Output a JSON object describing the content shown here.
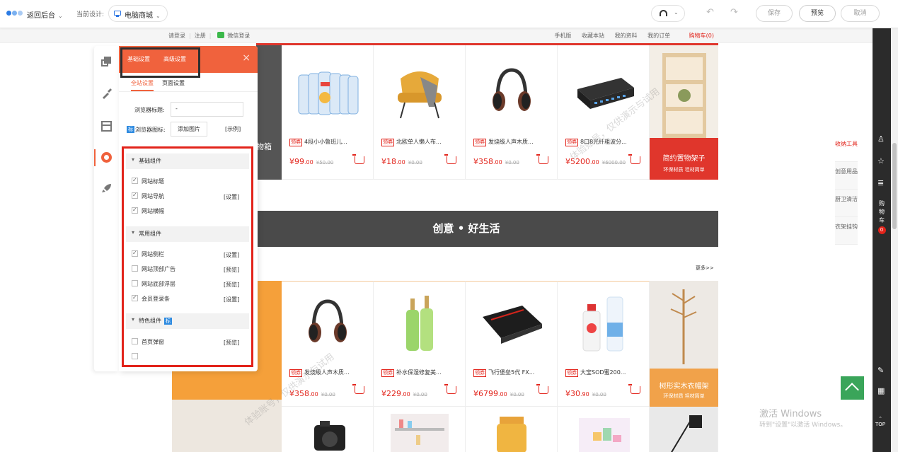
{
  "toolbar": {
    "back_label": "返回后台",
    "current_design_label": "当前设计:",
    "device_value": "电脑商城",
    "save_label": "保存",
    "preview_label": "预览",
    "cancel_label": "取消"
  },
  "shop_topbar": {
    "login": "请登录",
    "register": "注册",
    "wechat_login": "微信登录",
    "mobile": "手机版",
    "favorite": "收藏本站",
    "my_info": "我的资料",
    "my_orders": "我的订单",
    "cart": "购物车",
    "cart_count": "(0)"
  },
  "row1_products": [
    {
      "tag": "领券",
      "name": "4段小小鲁班儿...",
      "price": "¥99",
      "cents": ".00",
      "original": "¥50.00"
    },
    {
      "tag": "领券",
      "name": "北欧单人懒人布...",
      "price": "¥18",
      "cents": ".00",
      "original": "¥0.00"
    },
    {
      "tag": "领券",
      "name": "发烧级人声木质...",
      "price": "¥358",
      "cents": ".00",
      "original": "¥0.00"
    },
    {
      "tag": "领券",
      "name": "8口8光纤粗波分...",
      "price": "¥5200",
      "cents": ".00",
      "original": "¥6000.00"
    }
  ],
  "row1_partial_label": "物箱",
  "row1_banner": {
    "title": "简约置物架子",
    "subtitle": "环保材质 坦材简单"
  },
  "slogan": "创意 • 好生活",
  "more_label": "更多>>",
  "row2_products": [
    {
      "tag": "领券",
      "name": "发烧级人声木质...",
      "price": "¥358",
      "cents": ".00",
      "original": "¥0.00"
    },
    {
      "tag": "领券",
      "name": "补水保湿修复美...",
      "price": "¥229",
      "cents": ".00",
      "original": "¥0.00"
    },
    {
      "tag": "领券",
      "name": "飞行堡垒5代 FX...",
      "price": "¥6799",
      "cents": ".00",
      "original": "¥0.00"
    },
    {
      "tag": "领券",
      "name": "大宝SOD蜜200...",
      "price": "¥30",
      "cents": ".90",
      "original": "¥0.00"
    }
  ],
  "row2_banner": {
    "title": "树形实木衣帽架",
    "subtitle": "环保材质 坦材简单"
  },
  "float_categories": [
    {
      "label": "收纳工具"
    },
    {
      "label": "创意用品"
    },
    {
      "label": "厨卫清洁"
    },
    {
      "label": "衣架挂钩"
    }
  ],
  "sidebar": {
    "cart_label": "购物车",
    "cart_badge": "0",
    "top_label": "TOP"
  },
  "watermark_text": "体验账号，仅供演示与试用",
  "windows_activation": {
    "title": "激活 Windows",
    "hint": "转到\"设置\"以激活 Windows。"
  },
  "panel": {
    "tab_basic": "基础设置",
    "tab_advanced": "高级设置",
    "subtab_site": "全站设置",
    "subtab_page": "页面设置",
    "browser_title_label": "浏览器标题:",
    "browser_title_value": "-",
    "icon_badge": "标",
    "browser_icon_label": "浏览器图标:",
    "add_image_button": "添加图片",
    "example_link": "[示例]",
    "groups": {
      "basic": "基础组件",
      "common": "常用组件",
      "feature": "特色组件",
      "feature_badge": "标"
    },
    "basic_items": [
      {
        "label": "网站标题",
        "checked": true,
        "action": ""
      },
      {
        "label": "网站导航",
        "checked": true,
        "action": "[设置]"
      },
      {
        "label": "网站横幅",
        "checked": true,
        "action": ""
      }
    ],
    "common_items": [
      {
        "label": "网站侧栏",
        "checked": true,
        "action": "[设置]"
      },
      {
        "label": "网站顶部广告",
        "checked": false,
        "action": "[预览]"
      },
      {
        "label": "网站底部浮层",
        "checked": false,
        "action": "[预览]"
      },
      {
        "label": "会员登录条",
        "checked": true,
        "action": "[设置]"
      }
    ],
    "feature_items": [
      {
        "label": "首页弹窗",
        "checked": false,
        "action": "[预览]"
      }
    ]
  },
  "colors": {
    "accent": "#f0623d",
    "price": "#e2231a",
    "highlight_box": "#e2231a",
    "link": "#2f8be0"
  }
}
